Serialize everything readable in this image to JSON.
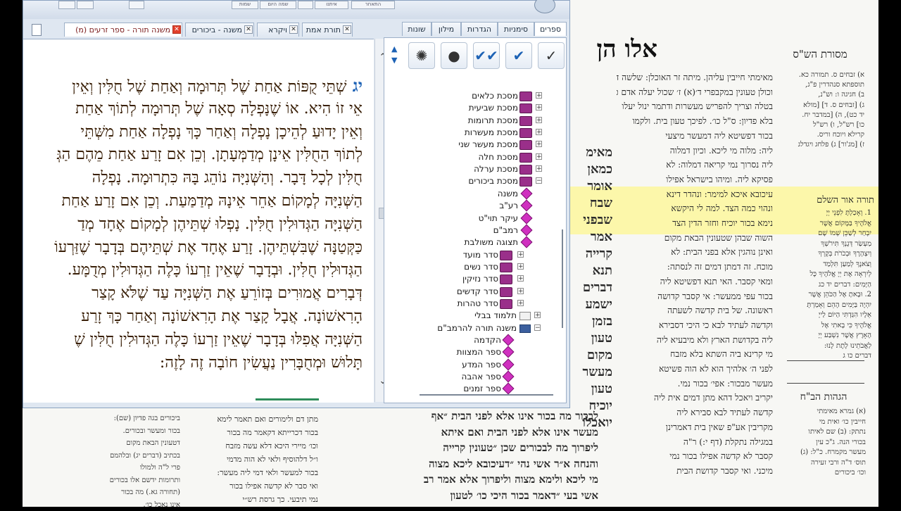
{
  "background_page": {
    "title": "אלו הן",
    "masoret_title": "מסורת הש\"ס",
    "torah_title": "תורה אור השלם",
    "hagahot_title": "הגהות הב\"ח",
    "center_col": [
      "מאימ",
      "כמאן",
      "אומר",
      "שבח",
      "שבפני",
      "אמר",
      "קרייה",
      "תנא",
      "דברים",
      "ישמע",
      "בזמן",
      "טעון",
      "מקום",
      "מעשר",
      "טעון",
      "יוכיח",
      "יואכלו"
    ],
    "rashi_col": [
      "מאימתי חייבין עליהן. מיתה זר האוכלן: שלשה ד",
      "וכולן טעונין במקבפרי ד׳(א) ז׳ שכול יעלה אדם כו׳. קס",
      "בטלה וצריך להפריש מעשרות ודתמר ינול יעלו",
      "בלא פדיון: ס\"ל כו׳. לפיכך טעון בית. ולקמו",
      "בכור דפשיטא ליה דמעשר מיצעי",
      "ליה: מלוה מי ליכא. וכיון דמלוה",
      "ליה נסרוך נמי קריאה דמלוה: לא",
      "פסיקא ליה. ומיהו בישראל אפילו",
      "עיכובא איכא למימר: ונהדר דינא",
      "ונהוי כמה הצד. למה לי היקשא",
      "נימא בכור יוכיח וחזר הדין הצד",
      "השוה שבהן שטעונין הבאת מקום",
      "ואינן נוהגין אלא בפני הבית: לא",
      "מוכח. זה דמתן דמים זה לנסתה:",
      "ומאי קסבר. האי תנא דפשיטא ליה",
      "בכור עפי ממעשר: אי קסבר קדושה",
      "ראשונה. של בית קדשה לשעתה",
      "וקדשה לעתיד לבא כי היכי דסבירא",
      "ליה בקדושת הארץ ולא מיבעיא ליה",
      "מי קרינא ביה השתא בלא מזבח",
      "לפני ה׳ אלהיך הוא לא הוה פשיטא",
      "מעשר מבכור: אפי׳ בכור נמי.",
      "יקריב ויאכל דהא מתן דמים אית ליה",
      "קדשה לעתיד לבא סבירא ליה",
      "מקריבין אע\"פ שאין בית דאמרינן",
      "במגילה נתקלת (דף י:) ר\"ה",
      "קסבר לא קדשה אפילו בכור נמי",
      "מיכני. ואי קסבר קדושת הבית"
    ],
    "masoret_col": [
      "א) זבחים ס. תמורה כא.",
      "תוספתא סנהדרין פ\"ג,",
      "ב) חגיגה ו: וש\"נ,",
      "ג) [זבחים ס. ד] [מולא",
      "יד כט), ה) [במדבר יח.",
      "כו] רש\"ל, ו) רש\"ל",
      "קרילא ויוכח וריס.",
      "ז) [מג'ור] ג) פלחג ויגדלג"
    ],
    "torah_col": [
      "1. וְאָכַלְתָּ לִפְנֵי יְיָ",
      "אֱלֹהֶיךָ בַּמָּקוֹם אֲשֶׁר",
      "יִבְחַר לְשַׁכֵּן שְׁמוֹ שָׁם",
      "מַעְשַׂר דְּגָנְךָ תִּירֹשְׁךָ",
      "וְיִצְהָרֶךָ וּבְכֹרֹת בְּקָרְךָ",
      "וְצֹאנֶךָ לְמַעַן תִּלְמַד",
      "לְיִרְאָה אֶת יְיָ אֱלֹהֶיךָ כָּל",
      "הַיָּמִים: דברים יד כג",
      "2. וּבָאתָ אֶל הַכֹּהֵן אֲשֶׁר",
      "יִהְיֶה בַּיָּמִים הָהֵם וְאָמַרְתָּ",
      "אֵלָיו הִגַּדְתִּי הַיּוֹם לַייָ",
      "אֱלֹהֶיךָ כִּי בָאתִי אֶל",
      "הָאָרֶץ אֲשֶׁר נִשְׁבַּע יְיָ",
      "לַאֲבֹתֵינוּ לָתֶת לָנוּ:",
      "דברים כו ג"
    ],
    "hagahot_col": [
      "(א) גמרא מאימתי",
      "חייבין כו׳ ואית מי",
      "נתתק: (ב) שם לאיתו",
      "בכורי הנה. ג\"כ עין",
      "מעשר מקמרח. כ\"ל: (ג)",
      "תוס׳ ד\"ה ורבי זעירה",
      "וכו׳ ביכורים"
    ],
    "bottom_cols": [
      [
        "ביכורים בגה פדיון (שם):",
        "בכור ומעשר ובכורים.",
        "דטעונין הבאת מקום",
        "בכתיב (דברים יג) ובלהמם",
        "פרי ל\"ה ולמולו",
        "ותרומות ידשם אלו בכורים",
        "(תחורה גא.) מה בכור",
        "אינו נאכל כו׳."
      ],
      [
        "מתן דם ולימורים ואם תאמר לימא",
        "בכור דכרייתא דקאמר מה בכור",
        "וכו׳ מיירי היכא דלא עשה מזבח",
        "ו״ל דלהוסיף ולאי לא הוה מדמי",
        "בכור למעשר ולאי דמי ליה מעשר:",
        "ואי סבר לא קדשה אפילו בכור",
        "נמי תיבעי. כך גרסת רש״י"
      ],
      [
        "לבכור מה בכור אינו אלא לפני הבית ״אף",
        "מעשר אינו אלא לפני הבית ואם איתא",
        "ליפרוך מה לבכורים שכן ״טעונין קרייה",
        "והנחה א״ר אשי נהי ״דעיכובא ליכא מצוה",
        "מי ליכא ולימא מצוה וליפרוך אלא אמר רב",
        "אשי בעי ״דאמר בכור היכי כו׳ לטעון"
      ]
    ]
  },
  "app": {
    "toolbar_buttons": [
      "",
      "",
      "",
      "שמות",
      "שמה היום",
      "",
      "איתנו",
      "התאחר"
    ],
    "doc_tabs": [
      {
        "label": "משנה תורה - ספר זרעים (מ)",
        "active": true
      },
      {
        "label": "משנה - ביכורים",
        "active": false
      },
      {
        "label": "ויקרא",
        "active": false
      },
      {
        "label": "תורת אמת",
        "active": false
      }
    ],
    "side_tabs": [
      "ספרים",
      "סימניות",
      "הגדרות",
      "מילון",
      "שונות"
    ],
    "side_icons": [
      "check-icon",
      "checkmark-blue-icon",
      "double-check-icon",
      "head-icon",
      "tree-icon"
    ],
    "reader": {
      "verse_number": "יג",
      "lines": [
        "שְׁתֵּי קֻפּוֹת אַחַת שֶׁל תְּרוּמָה וְאַחַת שֶׁל חֻלִּין וְאֵין",
        "אֵי זוֹ הִיא. אוֹ שֶׁנָּפְלָה סְאָה שֶׁל תְּרוּמָה לְתוֹךְ אַחַת",
        "וְאֵין יָדוּעַ לְהֵיכָן נָפְלָה וְאַחַר כָּךְ נָפְלָה אַחַת מִשְּׁתֵּי",
        "לְתוֹךְ הַחֻלִּין אֵינָן מְדַמְּעָתָן. וְכֵן אִם זָרַע אַחַת מֵהֶם הַגְּ",
        "חֻלִּין לְכָל דָּבָר. וְהַשְּׁנִיָּה נוֹהֵג בָּהּ כִּתְרוּמָה. נָפְלָה",
        "הַשְּׁנִיָּה לְמָקוֹם אַחֵר אֵינָהּ מְדַמַּעַת. וְכֵן אִם זָרַע אַחַת",
        "הַשְּׁנִיָּה הַגְּדוּלִין חֻלִּין. נָפְלוּ שְׁתֵּיהֶן לְמָקוֹם אֶחָד מְדַ",
        "כַּקְּטַנָּה שֶׁבִּשְׁתֵּיהֶן. זָרַע אֶחָד אֶת שְׁתֵּיהֶם בְּדָבָר שֶׁזַּרְעוֹ",
        "הַגְּדוּלִין חֻלִּין. וּבְדָבָר שֶׁאֵין זַרְעוֹ כָּלֶה הַגְּדוּלִין מְדֻמָּע.",
        "דְּבָרִים אֲמוּרִים בְּזוֹרֵעַ אֶת הַשְּׁנִיָּה עַד שֶׁלֹּא קָצַר",
        "הָרִאשׁוֹנָה. אֲבָל קָצַר אֶת הָרִאשׁוֹנָה וְאַחַר כָּךְ זָרַע",
        "הַשְּׁנִיָּה אֲפִלּוּ בְּדָבָר שֶׁאֵין זַרְעוֹ כָּלֶה הַגְּדוּלִין חֻלִּין שֶׁ",
        "תָּלוּשׁ וּמְחֻבָּרִין נַעֲשִׂין חוֹבָה זֶה לָזֶה:"
      ]
    },
    "tree": [
      {
        "label": "מסכת כלאים",
        "type": "book",
        "toggle": "+"
      },
      {
        "label": "מסכת שביעית",
        "type": "book",
        "toggle": "+"
      },
      {
        "label": "מסכת תרומות",
        "type": "book",
        "toggle": "+"
      },
      {
        "label": "מסכת מעשרות",
        "type": "book",
        "toggle": "+"
      },
      {
        "label": "מסכת מעשר שני",
        "type": "book",
        "toggle": "+"
      },
      {
        "label": "מסכת חלה",
        "type": "book",
        "toggle": "+"
      },
      {
        "label": "מסכת ערלה",
        "type": "book",
        "toggle": "+"
      },
      {
        "label": "מסכת ביכורים",
        "type": "book",
        "toggle": "−"
      },
      {
        "label": "משנה",
        "type": "dia",
        "toggle": ""
      },
      {
        "label": "רע\"ב",
        "type": "dia",
        "toggle": ""
      },
      {
        "label": "עיקר תוי\"ט",
        "type": "dia",
        "toggle": ""
      },
      {
        "label": "רמב\"ם",
        "type": "dia",
        "toggle": ""
      },
      {
        "label": "תצוגה משולבת",
        "type": "dia",
        "toggle": ""
      },
      {
        "label": "סדר מועד",
        "type": "book",
        "toggle": "+"
      },
      {
        "label": "סדר נשים",
        "type": "book",
        "toggle": "+"
      },
      {
        "label": "סדר נזיקין",
        "type": "book",
        "toggle": "+"
      },
      {
        "label": "סדר קדשים",
        "type": "book",
        "toggle": "+"
      },
      {
        "label": "סדר טהרות",
        "type": "book",
        "toggle": "+"
      },
      {
        "label": "תלמוד בבלי",
        "type": "folder",
        "toggle": "+"
      },
      {
        "label": "משנה תורה להרמב\"ם",
        "type": "folder-open",
        "toggle": "−"
      },
      {
        "label": "הקדמה",
        "type": "dia",
        "toggle": ""
      },
      {
        "label": "ספר המצוות",
        "type": "dia",
        "toggle": ""
      },
      {
        "label": "ספר המדע",
        "type": "dia",
        "toggle": ""
      },
      {
        "label": "ספר אהבה",
        "type": "dia",
        "toggle": ""
      },
      {
        "label": "ספר זמנים",
        "type": "dia",
        "toggle": ""
      }
    ]
  }
}
